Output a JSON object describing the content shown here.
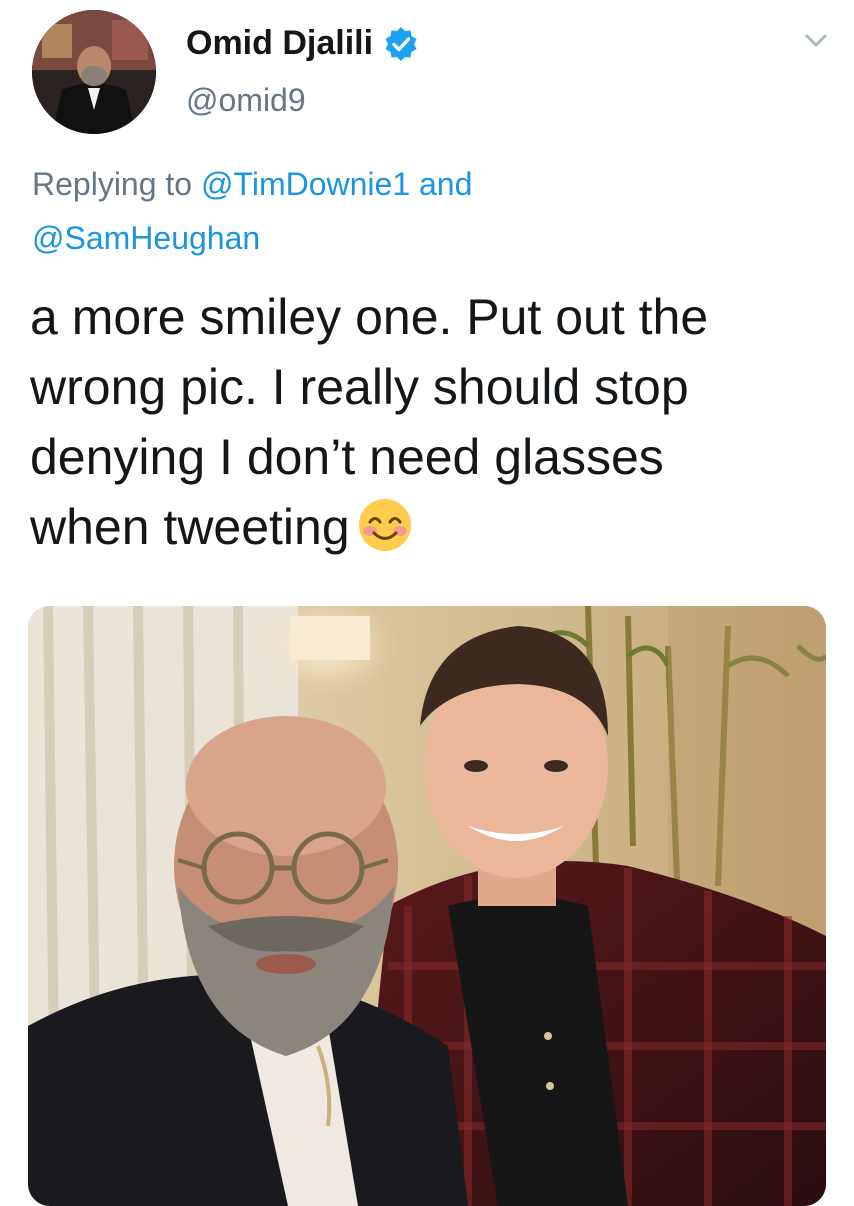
{
  "tweet": {
    "author_name": "Omid Djalili",
    "handle": "@omid9",
    "reply": {
      "prefix": "Replying to ",
      "mention_1": "@TimDownie1",
      "joiner": " and",
      "mention_2": "@SamHeughan"
    },
    "text_lines": [
      "a more smiley one. Put out the",
      "wrong pic. I really should stop",
      "denying I don’t need glasses",
      "when tweeting"
    ],
    "emoji": "smiling-face-with-smiling-eyes",
    "verified": true
  },
  "colors": {
    "text": "#14171a",
    "secondary": "#657786",
    "link": "#1b95e0",
    "verified": "#1da1f2"
  },
  "icons": [
    "verified-badge-icon",
    "chevron-down-icon",
    "smiling-face-emoji"
  ]
}
